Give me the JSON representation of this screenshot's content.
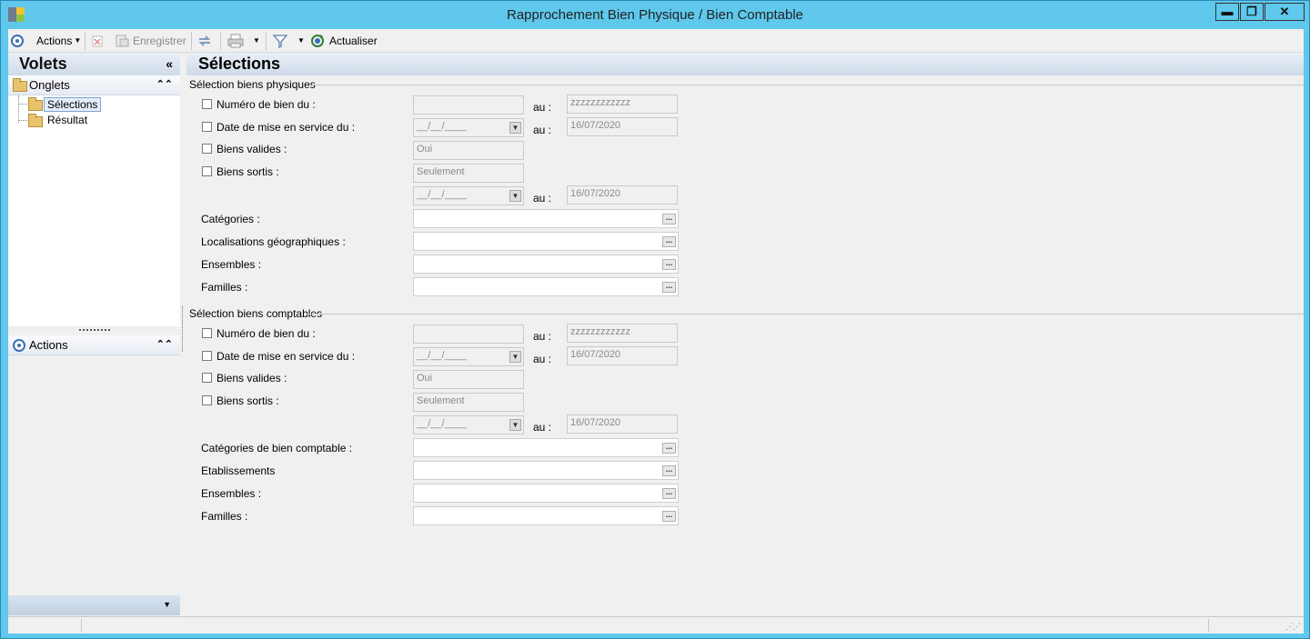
{
  "window": {
    "title": "Rapprochement Bien Physique / Bien Comptable",
    "minimize": "▬",
    "maximize": "❐",
    "close": "✕"
  },
  "toolbar": {
    "actions_label": "Actions",
    "enregistrer_label": "Enregistrer",
    "actualiser_label": "Actualiser"
  },
  "left_panel": {
    "title": "Volets",
    "collapse": "«",
    "onglets_label": "Onglets",
    "tree_items": [
      "Sélections",
      "Résultat"
    ],
    "actions_label": "Actions",
    "chevron_up": "⌃",
    "chevron_down": "▼"
  },
  "main": {
    "title": "Sélections",
    "au_label": "au :",
    "physiques": {
      "group_title": "Sélection biens physiques",
      "numero_label": "Numéro de bien du :",
      "numero_from": "",
      "numero_to": "zzzzzzzzzzzz",
      "date_label": "Date de mise en service du :",
      "date_from": "__/__/____",
      "date_to": "16/07/2020",
      "valides_label": "Biens valides :",
      "valides_value": "Oui",
      "sortis_label": "Biens sortis :",
      "sortis_value": "Seulement",
      "sortis_date_from": "__/__/____",
      "sortis_date_to": "16/07/2020",
      "categories_label": "Catégories :",
      "localisations_label": "Localisations géographiques :",
      "ensembles_label": "Ensembles :",
      "familles_label": "Familles :"
    },
    "comptables": {
      "group_title": "Sélection biens comptables",
      "numero_label": "Numéro de bien du :",
      "numero_from": "",
      "numero_to": "zzzzzzzzzzzz",
      "date_label": "Date de mise en service du :",
      "date_from": "__/__/____",
      "date_to": "16/07/2020",
      "valides_label": "Biens valides :",
      "valides_value": "Oui",
      "sortis_label": "Biens sortis :",
      "sortis_value": "Seulement",
      "sortis_date_from": "__/__/____",
      "sortis_date_to": "16/07/2020",
      "categories_label": "Catégories de bien comptable :",
      "etablissements_label": "Etablissements",
      "ensembles_label": "Ensembles :",
      "familles_label": "Familles :"
    }
  }
}
